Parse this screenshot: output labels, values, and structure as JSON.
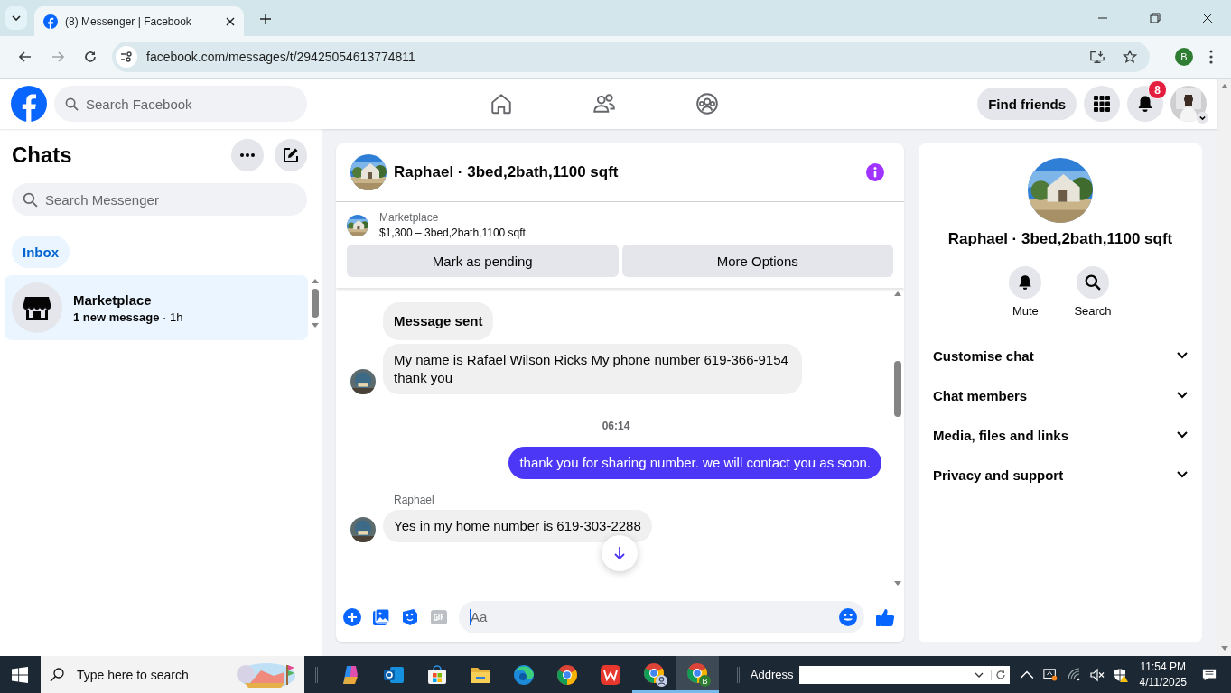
{
  "browser": {
    "tab_title": "(8) Messenger | Facebook",
    "url": "facebook.com/messages/t/29425054613774811",
    "profile_initial": "B"
  },
  "header": {
    "search_placeholder": "Search Facebook",
    "find_friends": "Find friends",
    "notification_count": "8"
  },
  "chats": {
    "title": "Chats",
    "search_placeholder": "Search Messenger",
    "filters": [
      {
        "label": "Inbox",
        "selected": true
      }
    ],
    "conversations": [
      {
        "name": "Marketplace",
        "subtitle": "**1 new message** · 1h",
        "selected": true
      }
    ]
  },
  "conversation": {
    "title": "Raphael · 3bed,2bath,1100 sqft",
    "listing_source": "Marketplace",
    "listing_title": "$1,300 – 3bed,2bath,1100 sqft",
    "actions": [
      "Mark as pending",
      "More Options"
    ],
    "messages": [
      {
        "kind": "notice",
        "text": "Message sent"
      },
      {
        "kind": "received",
        "text": "My name is Rafael Wilson Ricks My phone number 619-366-9154 thank you"
      },
      {
        "kind": "timestamp",
        "text": "06:14"
      },
      {
        "kind": "sent",
        "text": "thank you for sharing number. we will contact you as soon."
      },
      {
        "kind": "received",
        "sender": "Raphael",
        "text": "Yes in my home number is 619-303-2288"
      }
    ],
    "composer_placeholder": "Aa"
  },
  "details": {
    "name": "Raphael · 3bed,2bath,1100 sqft",
    "actions": [
      {
        "kind": "mute",
        "label": "Mute"
      },
      {
        "kind": "search",
        "label": "Search"
      }
    ],
    "sections": [
      {
        "label": "Customise chat",
        "expanded": false
      },
      {
        "label": "Chat members",
        "expanded": false
      },
      {
        "label": "Media, files and links",
        "expanded": false
      },
      {
        "label": "Privacy and support",
        "expanded": false
      }
    ]
  },
  "taskbar": {
    "search_placeholder": "Type here to search",
    "apps": [
      {
        "kind": "copilot",
        "running": false,
        "selected": false
      },
      {
        "kind": "outlook",
        "running": false,
        "selected": false
      },
      {
        "kind": "store",
        "running": false,
        "selected": false
      },
      {
        "kind": "explorer",
        "running": false,
        "selected": false
      },
      {
        "kind": "edge",
        "running": false,
        "selected": false
      },
      {
        "kind": "chrome",
        "running": false,
        "selected": false
      },
      {
        "kind": "wps",
        "running": false,
        "selected": false
      },
      {
        "kind": "chrome-profile",
        "running": true,
        "selected": false
      },
      {
        "kind": "chrome-lettered",
        "badge": "B",
        "running": true,
        "selected": true
      }
    ],
    "address_label": "Address",
    "time": "11:54 PM",
    "date": "4/11/2025"
  }
}
